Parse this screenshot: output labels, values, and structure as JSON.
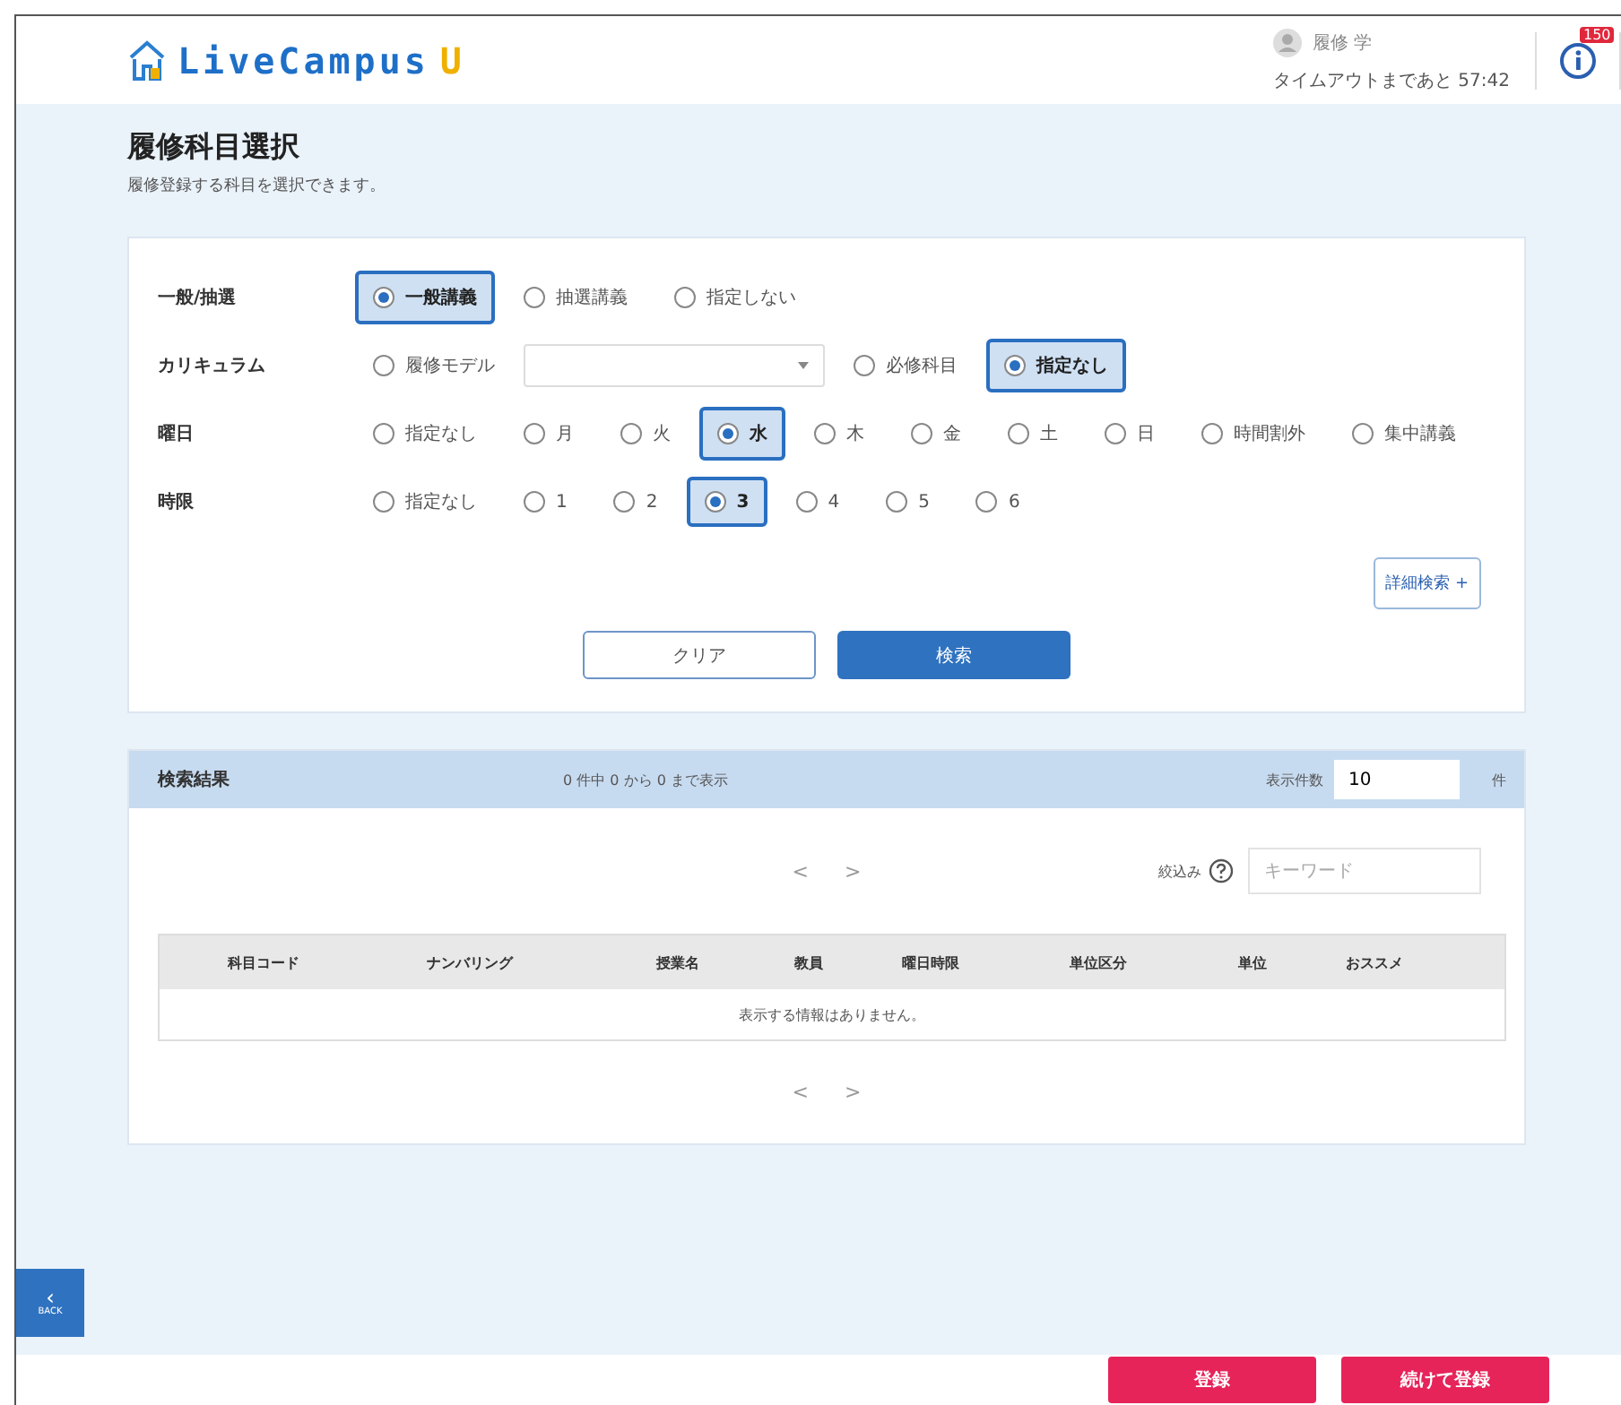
{
  "header": {
    "logo": "LiveCampus",
    "logo_mark": "U",
    "user_name": "履修 学",
    "timeout": "タイムアウトまであと 57:42",
    "notification_count": "150"
  },
  "page": {
    "title": "履修科目選択",
    "subtitle": "履修登録する科目を選択できます。"
  },
  "filters": [
    {
      "label": "一般/抽選",
      "options": [
        {
          "kind": "radio",
          "label": "一般講義",
          "selected": true
        },
        {
          "kind": "radio",
          "label": "抽選講義",
          "selected": false
        },
        {
          "kind": "radio",
          "label": "指定しない",
          "selected": false
        }
      ]
    },
    {
      "label": "カリキュラム",
      "options": [
        {
          "kind": "radio",
          "label": "履修モデル",
          "selected": false
        },
        {
          "kind": "select"
        },
        {
          "kind": "radio",
          "label": "必修科目",
          "selected": false
        },
        {
          "kind": "radio",
          "label": "指定なし",
          "selected": true
        }
      ]
    },
    {
      "label": "曜日",
      "options": [
        {
          "kind": "radio",
          "label": "指定なし",
          "selected": false
        },
        {
          "kind": "radio",
          "label": "月",
          "selected": false
        },
        {
          "kind": "radio",
          "label": "火",
          "selected": false
        },
        {
          "kind": "radio",
          "label": "水",
          "selected": true
        },
        {
          "kind": "radio",
          "label": "木",
          "selected": false
        },
        {
          "kind": "radio",
          "label": "金",
          "selected": false
        },
        {
          "kind": "radio",
          "label": "土",
          "selected": false
        },
        {
          "kind": "radio",
          "label": "日",
          "selected": false
        },
        {
          "kind": "radio",
          "label": "時間割外",
          "selected": false
        },
        {
          "kind": "radio",
          "label": "集中講義",
          "selected": false
        }
      ]
    },
    {
      "label": "時限",
      "options": [
        {
          "kind": "radio",
          "label": "指定なし",
          "selected": false
        },
        {
          "kind": "radio",
          "label": "1",
          "selected": false
        },
        {
          "kind": "radio",
          "label": "2",
          "selected": false
        },
        {
          "kind": "radio",
          "label": "3",
          "selected": true
        },
        {
          "kind": "radio",
          "label": "4",
          "selected": false
        },
        {
          "kind": "radio",
          "label": "5",
          "selected": false
        },
        {
          "kind": "radio",
          "label": "6",
          "selected": false
        }
      ]
    }
  ],
  "advanced_search": "詳細検索",
  "advanced_icon": "+",
  "buttons": {
    "clear": "クリア",
    "search": "検索"
  },
  "results": {
    "title": "検索結果",
    "summary": "0 件中 0 から 0 まで表示",
    "per_page_label": "表示件数",
    "per_page": "10",
    "per_page_unit": "件",
    "pager": [
      "<",
      ">"
    ],
    "filter_label": "絞込み",
    "keyword_placeholder": "キーワード",
    "table": {
      "columns": [
        "科目コード",
        "ナンバリング",
        "授業名",
        "教員",
        "曜日時限",
        "単位区分",
        "単位",
        "おススメ"
      ],
      "empty": "表示する情報はありません。"
    },
    "pager_bottom": [
      "<",
      ">"
    ]
  },
  "back": {
    "arrow": "‹",
    "label": "BACK"
  },
  "footer_buttons": [
    "登録",
    "続けて登録"
  ]
}
